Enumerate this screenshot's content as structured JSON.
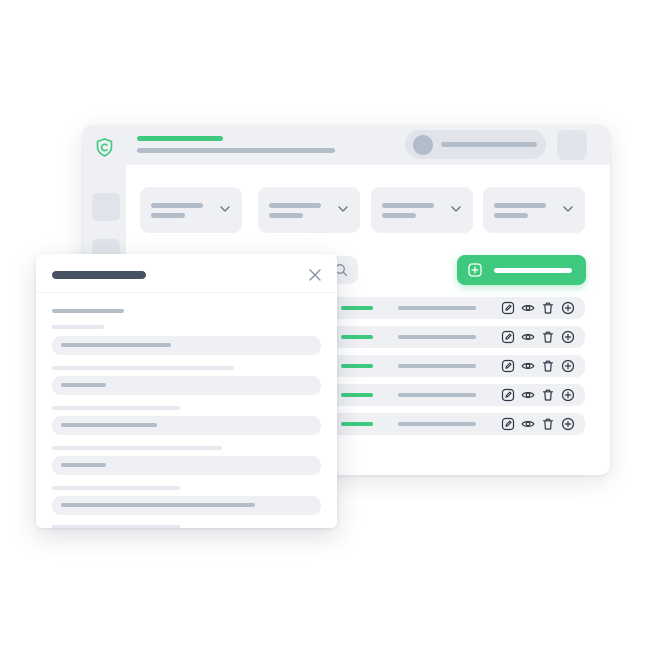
{
  "app": {
    "logo_icon": "shield-c-logo-icon",
    "accent_color": "#3ec97f"
  },
  "filters": {
    "count": 4,
    "chevron_icon": "chevron-down-icon"
  },
  "toolbar": {
    "search_icon": "search-icon",
    "add_icon": "plus-square-icon"
  },
  "table": {
    "row_actions": [
      "edit-icon",
      "view-icon",
      "delete-icon",
      "add-icon"
    ],
    "row_count": 5
  },
  "modal": {
    "close_icon": "close-icon",
    "field_count": 5
  }
}
